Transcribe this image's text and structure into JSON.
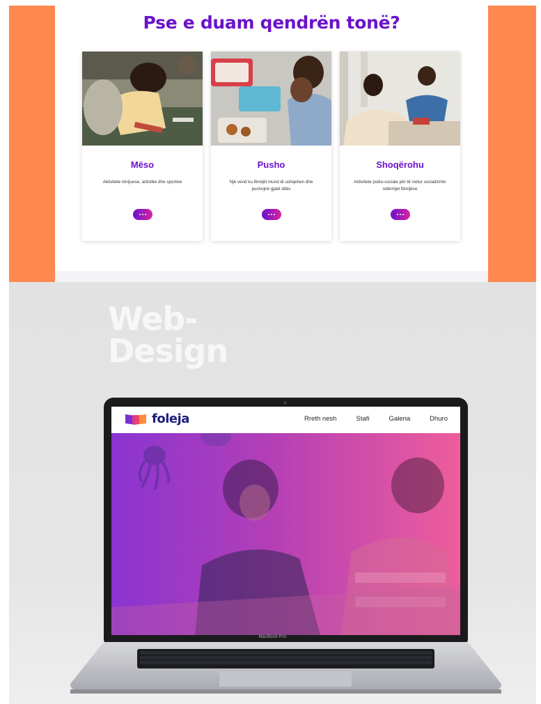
{
  "top_section": {
    "title": "Pse e duam qendrën tonë?",
    "cards": [
      {
        "title": "Mëso",
        "description": "Aktivitete rikrijuese, artistike dhe sportive"
      },
      {
        "title": "Pusho",
        "description": "Një vend ku fëmijët mund të ushqehen dhe pushojnë gjatë ditës"
      },
      {
        "title": "Shoqërohu",
        "description": "Aktivitete psiko-sociale për të nxitur socializimin ndërmjet fëmijëve"
      }
    ],
    "more_icon": "ellipsis-icon",
    "colors": {
      "accent": "#6a12c9",
      "frame": "#ff8750",
      "button_gradient_end": "#d726a3"
    }
  },
  "showcase": {
    "heading_line1": "Web-",
    "heading_line2": "Design",
    "laptop_label": "MacBook Pro"
  },
  "site": {
    "logo_text": "foleja",
    "nav": [
      "Rreth nesh",
      "Stafi",
      "Galeria",
      "Dhuro"
    ],
    "hero_gradient": [
      "#8a34d1",
      "#ee5d9c"
    ]
  }
}
